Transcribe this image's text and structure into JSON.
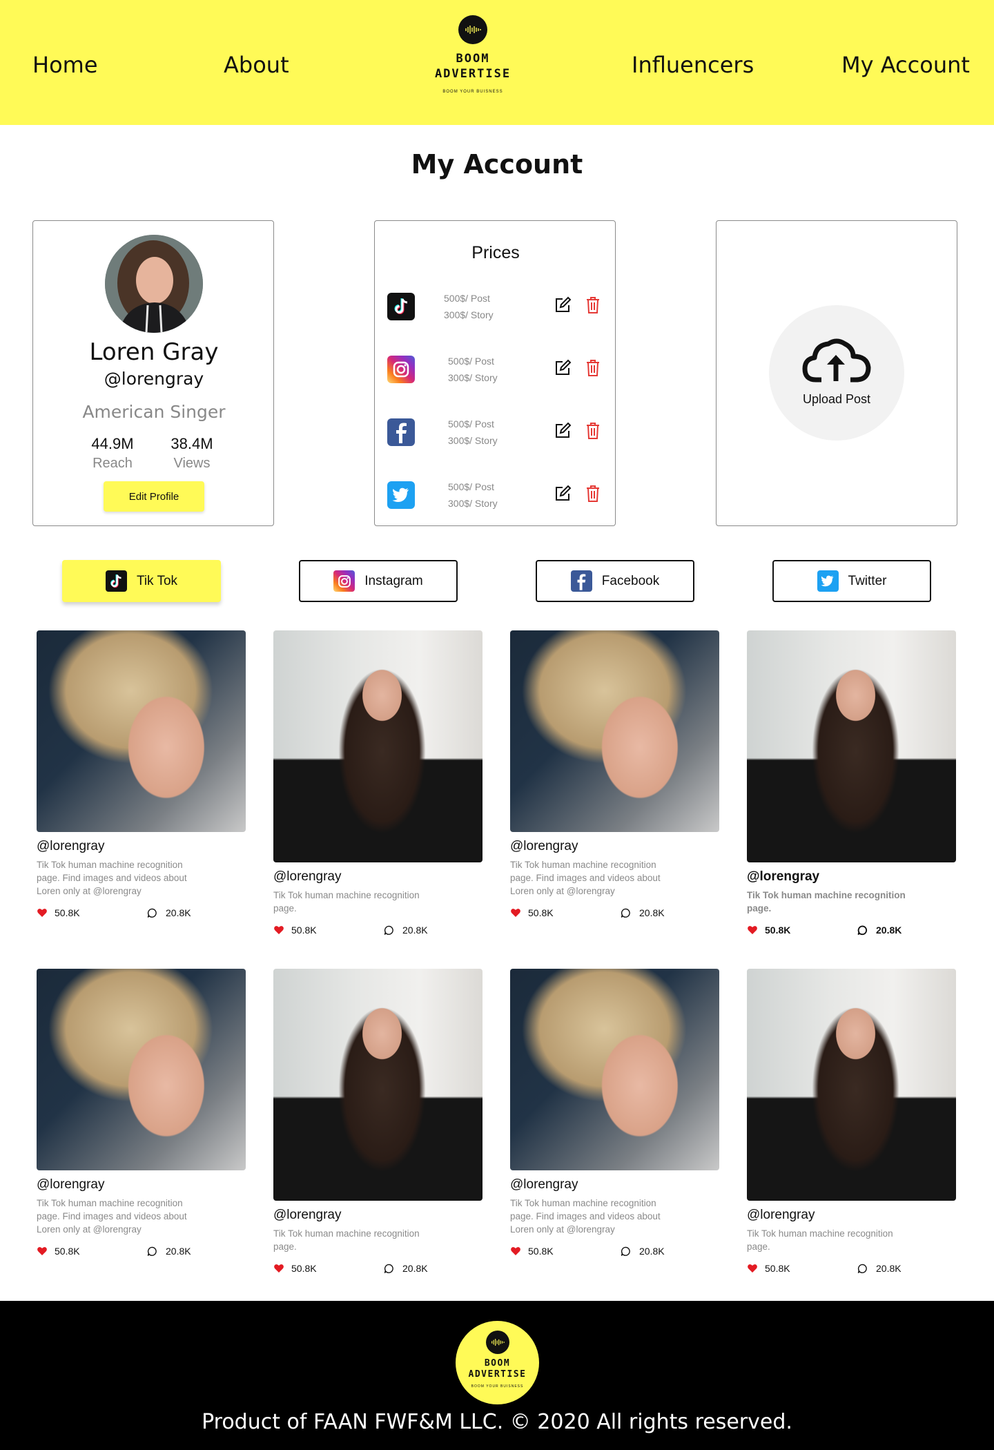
{
  "nav": {
    "home": "Home",
    "about": "About",
    "influencers": "Influencers",
    "my_account": "My Account"
  },
  "logo": {
    "line1": "BOOM",
    "line2": "ADVERTISE",
    "tagline": "BOOM YOUR BUISNESS"
  },
  "page_title": "My Account",
  "profile": {
    "name": "Loren Gray",
    "handle": "@lorengray",
    "role": "American Singer",
    "reach_value": "44.9M",
    "reach_label": "Reach",
    "views_value": "38.4M",
    "views_label": "Views",
    "edit_label": "Edit Profile"
  },
  "prices": {
    "title": "Prices",
    "rows": [
      {
        "platform": "tiktok",
        "post": "500$/ Post",
        "story": "300$/ Story"
      },
      {
        "platform": "instagram",
        "post": "500$/ Post",
        "story": "300$/ Story"
      },
      {
        "platform": "facebook",
        "post": "500$/ Post",
        "story": "300$/ Story"
      },
      {
        "platform": "twitter",
        "post": "500$/ Post",
        "story": "300$/ Story"
      }
    ]
  },
  "upload": {
    "label": "Upload Post"
  },
  "tabs": {
    "tiktok": "Tik Tok",
    "instagram": "Instagram",
    "facebook": "Facebook",
    "twitter": "Twitter",
    "active": "tiktok"
  },
  "posts": [
    {
      "handle": "@lorengray",
      "desc": "Tik Tok human machine recognition page. Find images and videos about Loren only at @lorengray",
      "likes": "50.8K",
      "comments": "20.8K"
    },
    {
      "handle": "@lorengray",
      "desc": "Tik Tok human machine recognition page.",
      "likes": "50.8K",
      "comments": "20.8K"
    },
    {
      "handle": "@lorengray",
      "desc": "Tik Tok human machine recognition page. Find images and videos about Loren only at @lorengray",
      "likes": "50.8K",
      "comments": "20.8K"
    },
    {
      "handle": "@lorengray",
      "desc": "Tik Tok human machine recognition page.",
      "likes": "50.8K",
      "comments": "20.8K"
    },
    {
      "handle": "@lorengray",
      "desc": "Tik Tok human machine recognition page. Find images and videos about Loren only at @lorengray",
      "likes": "50.8K",
      "comments": "20.8K"
    },
    {
      "handle": "@lorengray",
      "desc": "Tik Tok human machine recognition page.",
      "likes": "50.8K",
      "comments": "20.8K"
    },
    {
      "handle": "@lorengray",
      "desc": "Tik Tok human machine recognition page. Find images and videos about Loren only at @lorengray",
      "likes": "50.8K",
      "comments": "20.8K"
    },
    {
      "handle": "@lorengray",
      "desc": "Tik Tok human machine recognition page.",
      "likes": "50.8K",
      "comments": "20.8K"
    }
  ],
  "footer": {
    "logo_line1": "BOOM",
    "logo_line2": "ADVERTISE",
    "logo_tagline": "BOOM YOUR BUISNESS",
    "text": "Product of FAAN FWF&M LLC.  © 2020 All rights reserved."
  },
  "colors": {
    "brand_yellow": "#fffa57",
    "footer_black": "#000000",
    "delete_red": "#e53935",
    "heart_red": "#e31b23"
  },
  "icons": [
    "logo-sound-wave-icon",
    "tiktok-icon",
    "instagram-icon",
    "facebook-icon",
    "twitter-icon",
    "edit-icon",
    "trash-icon",
    "cloud-upload-icon",
    "heart-icon",
    "comment-icon"
  ]
}
